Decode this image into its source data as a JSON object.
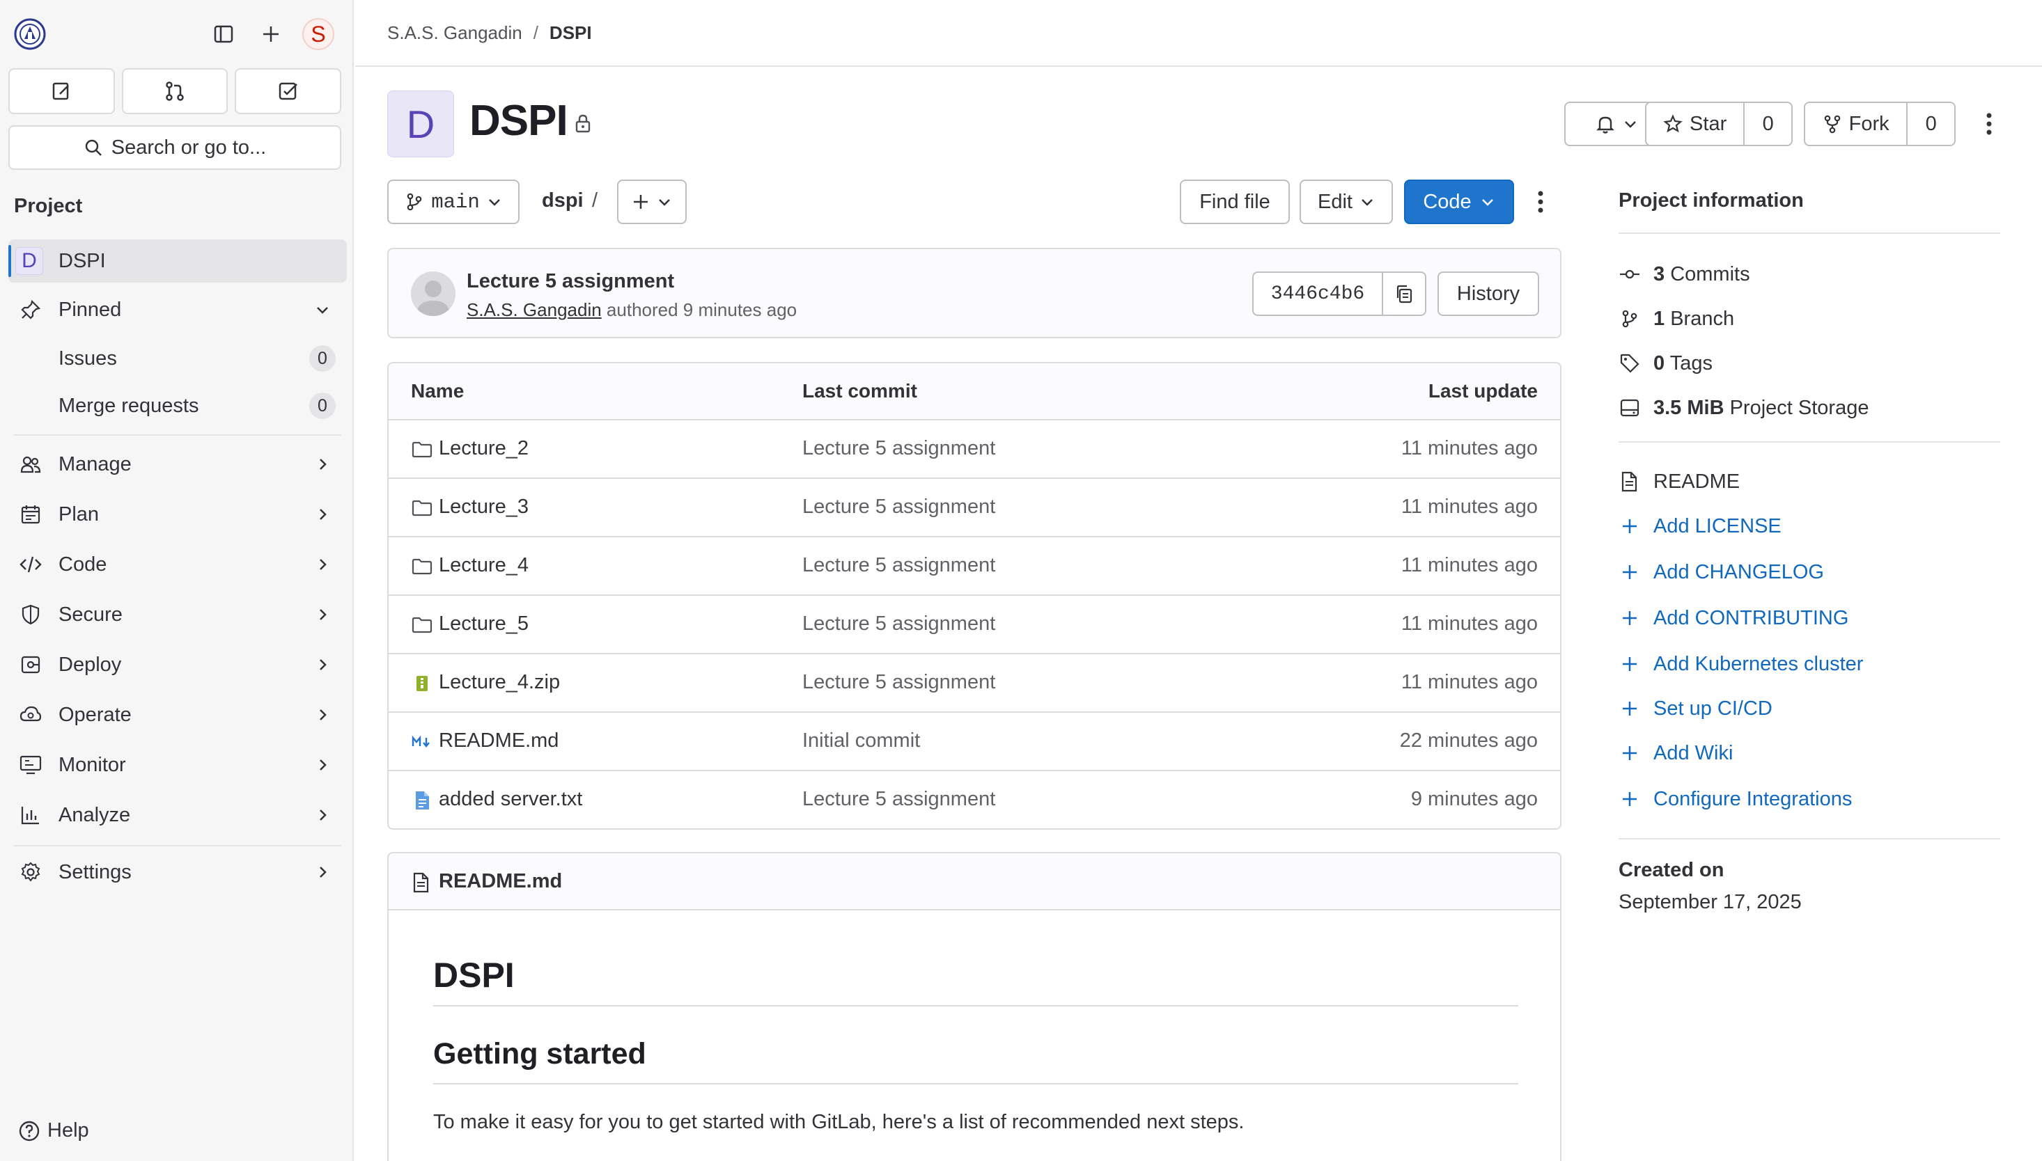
{
  "sidebar": {
    "search_label": "Search or go to...",
    "avatar_letter": "S",
    "section_title": "Project",
    "project_item": {
      "avatar": "D",
      "label": "DSPI"
    },
    "pinned_label": "Pinned",
    "pinned_items": [
      {
        "label": "Issues",
        "count": "0"
      },
      {
        "label": "Merge requests",
        "count": "0"
      }
    ],
    "nav_items": [
      {
        "label": "Manage",
        "icon": "users-icon"
      },
      {
        "label": "Plan",
        "icon": "calendar-icon"
      },
      {
        "label": "Code",
        "icon": "code-icon"
      },
      {
        "label": "Secure",
        "icon": "shield-icon"
      },
      {
        "label": "Deploy",
        "icon": "deploy-icon"
      },
      {
        "label": "Operate",
        "icon": "cloud-icon"
      },
      {
        "label": "Monitor",
        "icon": "monitor-icon"
      },
      {
        "label": "Analyze",
        "icon": "chart-icon"
      }
    ],
    "settings_label": "Settings",
    "help_label": "Help"
  },
  "breadcrumb": {
    "group": "S.A.S. Gangadin",
    "separator": "/",
    "project": "DSPI"
  },
  "project": {
    "avatar": "D",
    "title": "DSPI",
    "star_label": "Star",
    "star_count": "0",
    "fork_label": "Fork",
    "fork_count": "0"
  },
  "toolbar": {
    "branch": "main",
    "path": "dspi",
    "path_sep": "/",
    "find_file": "Find file",
    "edit": "Edit",
    "code": "Code"
  },
  "last_commit": {
    "title": "Lecture 5 assignment",
    "author": "S.A.S. Gangadin",
    "meta": "authored 9 minutes ago",
    "sha": "3446c4b6",
    "history": "History"
  },
  "files": {
    "headers": {
      "name": "Name",
      "last_commit": "Last commit",
      "last_update": "Last update"
    },
    "rows": [
      {
        "name": "Lecture_2",
        "type": "folder",
        "commit": "Lecture 5 assignment",
        "updated": "11 minutes ago"
      },
      {
        "name": "Lecture_3",
        "type": "folder",
        "commit": "Lecture 5 assignment",
        "updated": "11 minutes ago"
      },
      {
        "name": "Lecture_4",
        "type": "folder",
        "commit": "Lecture 5 assignment",
        "updated": "11 minutes ago"
      },
      {
        "name": "Lecture_5",
        "type": "folder",
        "commit": "Lecture 5 assignment",
        "updated": "11 minutes ago"
      },
      {
        "name": "Lecture_4.zip",
        "type": "zip",
        "commit": "Lecture 5 assignment",
        "updated": "11 minutes ago"
      },
      {
        "name": "README.md",
        "type": "markdown",
        "commit": "Initial commit",
        "updated": "22 minutes ago"
      },
      {
        "name": "added server.txt",
        "type": "text",
        "commit": "Lecture 5 assignment",
        "updated": "9 minutes ago"
      }
    ]
  },
  "readme": {
    "filename": "README.md",
    "h1": "DSPI",
    "h2": "Getting started",
    "paragraph": "To make it easy for you to get started with GitLab, here's a list of recommended next steps."
  },
  "project_info": {
    "title": "Project information",
    "stats": [
      {
        "value": "3",
        "label": "Commits",
        "icon": "commit-icon"
      },
      {
        "value": "1",
        "label": "Branch",
        "icon": "branch-icon"
      },
      {
        "value": "0",
        "label": "Tags",
        "icon": "tag-icon"
      },
      {
        "value": "3.5 MiB",
        "label": "Project Storage",
        "icon": "storage-icon"
      }
    ],
    "readme_link": "README",
    "actions": [
      "Add LICENSE",
      "Add CHANGELOG",
      "Add CONTRIBUTING",
      "Add Kubernetes cluster",
      "Set up CI/CD",
      "Add Wiki",
      "Configure Integrations"
    ],
    "created_label": "Created on",
    "created_value": "September 17, 2025"
  },
  "colors": {
    "primary": "#1f75cb",
    "link": "#1068bf",
    "sidebar_bg": "#f6f6f7",
    "border": "#dcdcde"
  }
}
